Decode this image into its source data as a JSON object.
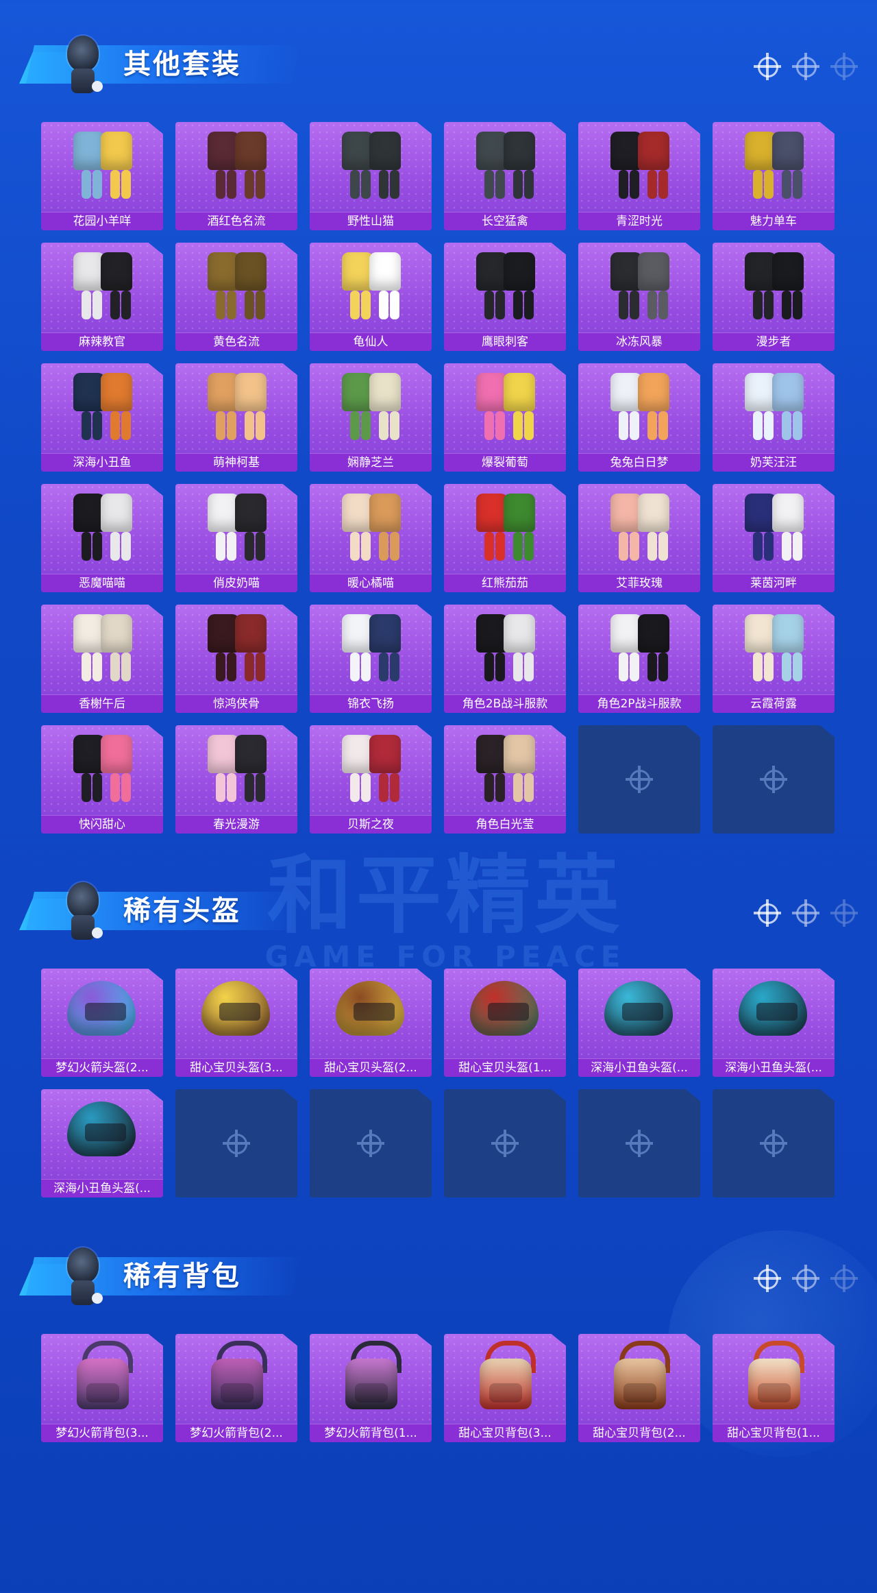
{
  "watermark": {
    "main": "和平精英",
    "sub": "GAME FOR PEACE"
  },
  "sections": [
    {
      "title": "其他套装",
      "items": [
        {
          "label": "花园小羊咩",
          "color": "#7fb4d8",
          "accent": "#f2c94c"
        },
        {
          "label": "酒红色名流",
          "color": "#5a2a35",
          "accent": "#6b3a2a"
        },
        {
          "label": "野性山猫",
          "color": "#3d4648",
          "accent": "#2f3537"
        },
        {
          "label": "长空猛禽",
          "color": "#40494d",
          "accent": "#2e3438"
        },
        {
          "label": "青涩时光",
          "color": "#1e1e24",
          "accent": "#a52a2a"
        },
        {
          "label": "魅力单车",
          "color": "#d9b12c",
          "accent": "#4a4f6a"
        },
        {
          "label": "麻辣教官",
          "color": "#e8e8ea",
          "accent": "#222226"
        },
        {
          "label": "黄色名流",
          "color": "#8a6b2e",
          "accent": "#6b5224"
        },
        {
          "label": "龟仙人",
          "color": "#f3d35a",
          "accent": "#ffffff"
        },
        {
          "label": "鹰眼刺客",
          "color": "#25272b",
          "accent": "#1b1c20"
        },
        {
          "label": "冰冻风暴",
          "color": "#2a2c30",
          "accent": "#5a5c62"
        },
        {
          "label": "漫步者",
          "color": "#232428",
          "accent": "#1a1b1f"
        },
        {
          "label": "深海小丑鱼",
          "color": "#1f3250",
          "accent": "#e07a2f"
        },
        {
          "label": "萌神柯基",
          "color": "#e0a060",
          "accent": "#f2c28a"
        },
        {
          "label": "娴静芝兰",
          "color": "#5c9a4a",
          "accent": "#e8e2c8"
        },
        {
          "label": "爆裂葡萄",
          "color": "#f06fb0",
          "accent": "#f0d44a"
        },
        {
          "label": "兔兔白日梦",
          "color": "#eef2f8",
          "accent": "#f2a45a"
        },
        {
          "label": "奶芙汪汪",
          "color": "#eaf2fb",
          "accent": "#9fc4ea"
        },
        {
          "label": "恶魔喵喵",
          "color": "#1c1c20",
          "accent": "#e8e8ea"
        },
        {
          "label": "俏皮奶喵",
          "color": "#f2f2f4",
          "accent": "#2a2a2e"
        },
        {
          "label": "暖心橘喵",
          "color": "#f2dcc6",
          "accent": "#d99a5a"
        },
        {
          "label": "红熊茄茄",
          "color": "#d9302a",
          "accent": "#3e8a2f"
        },
        {
          "label": "艾菲玫瑰",
          "color": "#f4b6a6",
          "accent": "#f0e2d2"
        },
        {
          "label": "莱茵河畔",
          "color": "#2a2f7a",
          "accent": "#f2f2f4"
        },
        {
          "label": "香榭午后",
          "color": "#f2ece2",
          "accent": "#e2d8c8"
        },
        {
          "label": "惊鸿侠骨",
          "color": "#3a1a1e",
          "accent": "#8a2a2a"
        },
        {
          "label": "锦衣飞扬",
          "color": "#f2f4f8",
          "accent": "#2a3a6a"
        },
        {
          "label": "角色2B战斗服款",
          "color": "#1a1a1e",
          "accent": "#e8e8ea"
        },
        {
          "label": "角色2P战斗服款",
          "color": "#f2f2f4",
          "accent": "#1a1a1e"
        },
        {
          "label": "云霞荷露",
          "color": "#f2e6d2",
          "accent": "#a6d2e8"
        },
        {
          "label": "快闪甜心",
          "color": "#1e1e24",
          "accent": "#f06f9a"
        },
        {
          "label": "春光漫游",
          "color": "#f2c6d6",
          "accent": "#2a2a30"
        },
        {
          "label": "贝斯之夜",
          "color": "#f2eaea",
          "accent": "#b02a3a"
        },
        {
          "label": "角色白光莹",
          "color": "#2a2226",
          "accent": "#e2c6a6"
        }
      ],
      "empty_slots": 2
    },
    {
      "title": "稀有头盔",
      "items": [
        {
          "label": "梦幻火箭头盔(2...",
          "color": "#8a5ad8",
          "accent": "#3acaf0"
        },
        {
          "label": "甜心宝贝头盔(3...",
          "color": "#f2d24a",
          "accent": "#7a4a2a"
        },
        {
          "label": "甜心宝贝头盔(2...",
          "color": "#8a4a22",
          "accent": "#f2d24a"
        },
        {
          "label": "甜心宝贝头盔(1...",
          "color": "#c0302a",
          "accent": "#3a8a6a"
        },
        {
          "label": "深海小丑鱼头盔(...",
          "color": "#3ab8d8",
          "accent": "#1a2a3a"
        },
        {
          "label": "深海小丑鱼头盔(...",
          "color": "#2aa8c8",
          "accent": "#1a2a3a"
        },
        {
          "label": "深海小丑鱼头盔(...",
          "color": "#2a9ac0",
          "accent": "#1a1a22"
        }
      ],
      "empty_slots": 5
    },
    {
      "title": "稀有背包",
      "items": [
        {
          "label": "梦幻火箭背包(3...",
          "color": "#d872c8",
          "accent": "#4a3a6a"
        },
        {
          "label": "梦幻火箭背包(2...",
          "color": "#c060b8",
          "accent": "#3a2f5a"
        },
        {
          "label": "梦幻火箭背包(1...",
          "color": "#c878d0",
          "accent": "#2a2a3a"
        },
        {
          "label": "甜心宝贝背包(3...",
          "color": "#e8d2b2",
          "accent": "#c0302a"
        },
        {
          "label": "甜心宝贝背包(2...",
          "color": "#e8c6a0",
          "accent": "#8a3a1a"
        },
        {
          "label": "甜心宝贝背包(1...",
          "color": "#f2e2c8",
          "accent": "#c84a2a"
        }
      ],
      "empty_slots": 0
    }
  ]
}
